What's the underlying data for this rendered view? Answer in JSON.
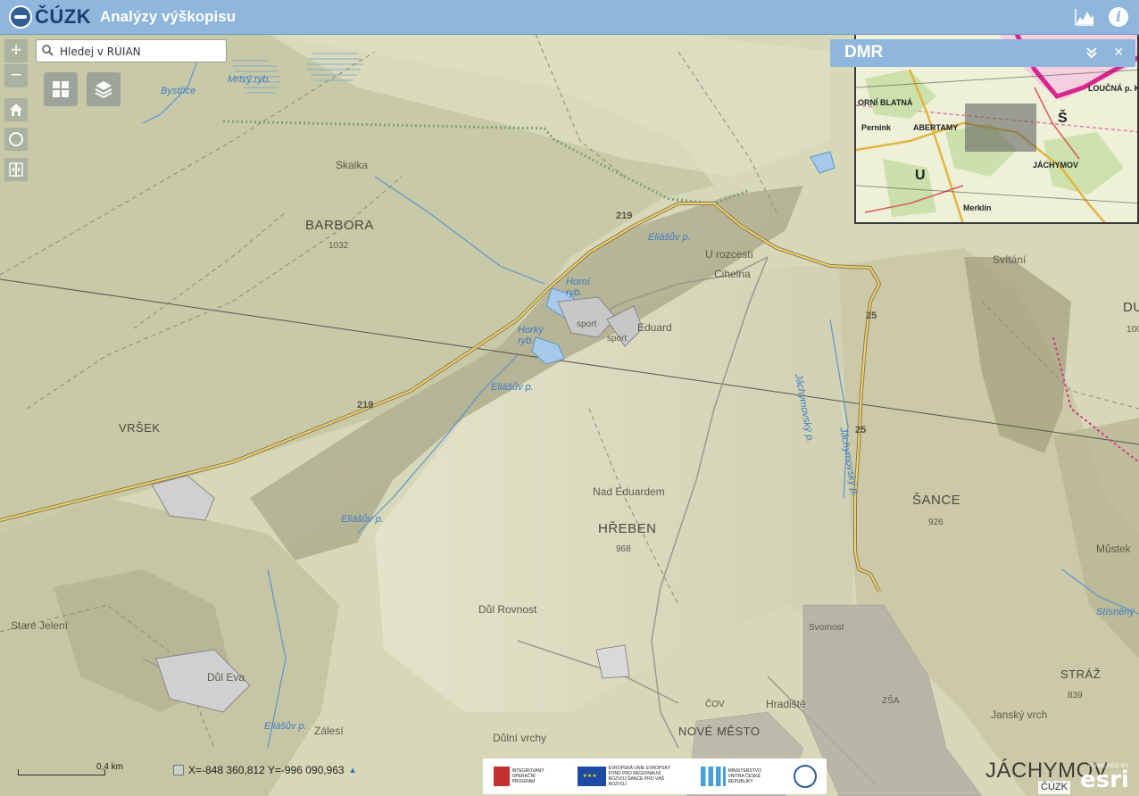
{
  "header": {
    "logo_text": "ČÚZK",
    "title": "Analýzy výškopisu",
    "profile_icon": "elevation-profile-icon",
    "info_glyph": "i"
  },
  "search": {
    "placeholder": "Hledej v RÚIAN"
  },
  "controls": {
    "zoom_in": "+",
    "zoom_out": "−"
  },
  "dmr_panel": {
    "title": "DMR",
    "close_glyph": "×"
  },
  "overview_labels": {
    "horni_blatna": "ORNÍ BLATNÁ",
    "abertamy": "ABERTAMY",
    "pernink": "Pernink",
    "jachymov": "JÁCHYMOV",
    "loucna": "LOUČNÁ p. K",
    "merklin": "Merklín",
    "u": "U",
    "s": "Š"
  },
  "map_labels": {
    "mrtvy": "Mrtvý ryb.",
    "bystrice": "Bystřice",
    "skalka": "Skalka",
    "barbora": "BARBORA",
    "barbora_h": "1032",
    "road219a": "219",
    "road219b": "219",
    "road25a": "25",
    "road25b": "25",
    "eliasuv1": "Eliášův p.",
    "eliasuv2": "Eliášův p.",
    "eliasuv3": "Eliášův p.",
    "eliasuv4": "Eliášův p.",
    "horni": "Horní ryb.",
    "horky": "Horký ryb.",
    "sport1": "sport",
    "sport2": "sport",
    "eduard": "Eduard",
    "urozcesti": "U rozcestí",
    "cihelna": "Cihelna",
    "vrsek": "VRŠEK",
    "nad_eduardem": "Nad Eduardem",
    "hreben": "HŘEBEN",
    "hreben_h": "968",
    "sance": "ŠANCE",
    "sance_h": "926",
    "svitani": "Svítání",
    "du": "DU",
    "du_h": "100",
    "mustek": "Můstek",
    "stisneny": "Stísněný",
    "jachymovsky1": "Jáchymovský p.",
    "jachymovsky2": "Jáchymovský p.",
    "stare_jeleni": "Staré Jelení",
    "dul_rovnost": "Důl Rovnost",
    "dul_eva": "Důl Eva",
    "zalesi": "Zálesí",
    "dulni_vrchy": "Důlní vrchy",
    "nove_mesto": "NOVÉ MĚSTO",
    "hradiste": "Hradiště",
    "svornost": "Svornost",
    "cov": "ČOV",
    "straz": "STRÁŽ",
    "straz_h": "839",
    "jansky": "Janský vrch",
    "jachymov_city": "JÁCHYMOV",
    "zsa": "ZŠA"
  },
  "footer": {
    "scale": "0,4 km",
    "coordinates": "X=-848 360,812  Y=-996 090,963",
    "logo1": "INTEGROVANÝ OPERAČNÍ PROGRAM",
    "logo2": "EVROPSKÁ UNIE EVROPSKÝ FOND PRO REGIONÁLNÍ ROZVOJ ŠANCE PRO VÁŠ ROZVOJ",
    "logo3": "MINISTERSTVO VNITRA ČESKÉ REPUBLIKY",
    "attribution": "ČÚZK",
    "esri_powered": "POWERED BY",
    "esri_name": "esri"
  }
}
